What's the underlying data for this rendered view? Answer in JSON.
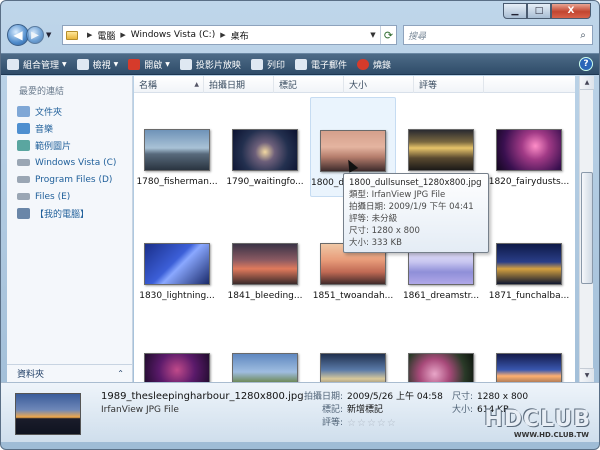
{
  "window": {
    "caption_buttons": {
      "minimize": "▁",
      "maximize": "□",
      "close": "X"
    }
  },
  "address": {
    "back_icon": "back-arrow-icon",
    "forward_icon": "forward-arrow-icon",
    "crumbs": [
      "電腦",
      "Windows Vista (C:)",
      "桌布"
    ],
    "search_placeholder": "搜尋"
  },
  "toolbar": {
    "items": [
      {
        "label": "組合管理",
        "has_dropdown": true,
        "icon": "organize-icon",
        "color": "#dfe8f2"
      },
      {
        "label": "檢視",
        "has_dropdown": true,
        "icon": "views-icon",
        "color": "#dfe8f2"
      },
      {
        "label": "開啟",
        "has_dropdown": true,
        "icon": "open-icon",
        "color": "#d63b2b"
      },
      {
        "label": "投影片放映",
        "has_dropdown": false,
        "icon": "slideshow-icon",
        "color": "#dfe8f2"
      },
      {
        "label": "列印",
        "has_dropdown": false,
        "icon": "print-icon",
        "color": "#dfe8f2"
      },
      {
        "label": "電子郵件",
        "has_dropdown": false,
        "icon": "email-icon",
        "color": "#dfe8f2"
      },
      {
        "label": "燒錄",
        "has_dropdown": false,
        "icon": "burn-icon",
        "color": "#d63b2b"
      }
    ],
    "help": "?"
  },
  "nav": {
    "heading": "最愛的連結",
    "items": [
      {
        "label": "文件夾",
        "icon": "documents-icon",
        "color": "#7fa7d6"
      },
      {
        "label": "音樂",
        "icon": "music-icon",
        "color": "#4e8fd0"
      },
      {
        "label": "範例圖片",
        "icon": "pictures-icon",
        "color": "#5aa6a0"
      },
      {
        "label": "Windows Vista (C)",
        "icon": "drive-icon",
        "color": "#9aa6b4"
      },
      {
        "label": "Program Files (D)",
        "icon": "drive-icon",
        "color": "#9aa6b4"
      },
      {
        "label": "Files (E)",
        "icon": "drive-icon",
        "color": "#9aa6b4"
      },
      {
        "label": "【我的電腦】",
        "icon": "computer-icon",
        "color": "#6a86a8"
      }
    ],
    "folders_label": "資料夾",
    "folders_chevron": "⌃"
  },
  "columns": [
    "名稱",
    "拍攝日期",
    "標記",
    "大小",
    "評等"
  ],
  "thumbnails": [
    {
      "caption": "1780_fisherman...",
      "gradient": "linear-gradient(#6f93b8 0%, #a9c2d6 45%, #586a7c 60%, #2a3440 100%)"
    },
    {
      "caption": "1790_waitingfo...",
      "gradient": "radial-gradient(circle at 50% 55%, #f2d8a2 0%, #6d5f7a 25%, #23304f 60%, #0c1230 100%)"
    },
    {
      "caption": "1800_dullsunset_1280x800.jpg",
      "gradient": "linear-gradient(#d4a08c 0%, #e4b4a0 40%, #b57d6c 65%, #3d2b2c 100%)"
    },
    {
      "caption": "1820_...",
      "gradient": "linear-gradient(#2a2a30 0%, #7a6840 30%, #e7c46a 45%, #5a4a30 70%, #1c1a18 100%)"
    },
    {
      "caption": "1820_fairydusts...",
      "gradient": "radial-gradient(circle at 60% 40%, #ff8ec8 0%, #a13a86 30%, #3a1050 70%, #12061e 100%)"
    },
    {
      "caption": "1830_lightning...",
      "gradient": "linear-gradient(135deg, #1a2f8a 0%, #3c5fd8 45%, #8aa8ff 55%, #1a2a6a 100%)"
    },
    {
      "caption": "1841_bleeding...",
      "gradient": "linear-gradient(#3a3346 0%, #8b5a62 40%, #e07a5c 62%, #3a2a2a 100%)"
    },
    {
      "caption": "1851_twoandah...",
      "gradient": "linear-gradient(#f0c8a6 0%, #e89c7a 40%, #c06a54 70%, #402a2a 100%)"
    },
    {
      "caption": "1861_dreamstr...",
      "gradient": "linear-gradient(#f4f0ff 0%, #c8c6f0 45%, #8f8fd8 70%, #b0a8e8 100%)"
    },
    {
      "caption": "1871_funchalba...",
      "gradient": "linear-gradient(#0e1a48 0%, #2a3e88 45%, #d4a040 62%, #101830 100%)"
    },
    {
      "caption": "",
      "gradient": "radial-gradient(circle at 50% 40%, #c04a8a 0%, #5a1a6a 45%, #12081e 100%)"
    },
    {
      "caption": "",
      "gradient": "linear-gradient(#5f88c0 0%, #9fbde0 45%, #6f8a5a 70%, #3a4a2a 100%)"
    },
    {
      "caption": "",
      "gradient": "linear-gradient(#20304e 0%, #5a7aa8 40%, #d8c89a 62%, #2a2a38 100%)"
    },
    {
      "caption": "",
      "gradient": "radial-gradient(circle at 40% 50%, #e8a6c8 0%, #a84a7a 35%, #2a3a28 70%, #0e140e 100%)"
    },
    {
      "caption": "",
      "gradient": "linear-gradient(#141a4a 0%, #3a58b0 40%, #ffb070 55%, #1a1a2a 100%)"
    }
  ],
  "tooltip": {
    "title": "1800_dullsunset_1280x800.jpg",
    "lines": [
      "類型: IrfanView JPG File",
      "拍攝日期: 2009/1/9 下午 04:41",
      "評等: 未分級",
      "尺寸: 1280 x 800",
      "大小: 333 KB"
    ]
  },
  "details": {
    "filename": "1989_thesleepingharbour_1280x800.jpg",
    "filetype": "IrfanView JPG File",
    "date_label": "拍攝日期:",
    "date_value": "2009/5/26 上午 04:58",
    "tags_label": "標記:",
    "tags_value": "新增標記",
    "rating_label": "評等:",
    "rating_value": 0,
    "rating_max": 5,
    "dims_label": "尺寸:",
    "dims_value": "1280 x 800",
    "size_label": "大小:",
    "size_value": "614 KB"
  },
  "watermark": {
    "main": "HDCLUB",
    "sub": "WWW.HD.CLUB.TW"
  }
}
